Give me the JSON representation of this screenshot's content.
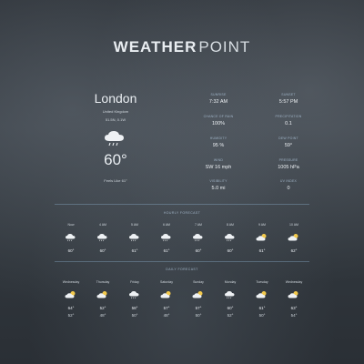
{
  "brand": {
    "part1": "WEATHER",
    "part2": "POINT"
  },
  "current": {
    "city": "London",
    "country": "United Kingdom",
    "coords": "51.5N, 0.1W",
    "temperature": "60°",
    "feels_like": "Feels Like 61°",
    "icon": "cloud-rain-icon"
  },
  "metrics": [
    {
      "label": "SUNRISE",
      "value": "7:32 AM"
    },
    {
      "label": "SUNSET",
      "value": "5:57 PM"
    },
    {
      "label": "CHANCE OF RAIN",
      "value": "100%"
    },
    {
      "label": "PRECIPITATION",
      "value": "0.1"
    },
    {
      "label": "HUMIDITY",
      "value": "95 %"
    },
    {
      "label": "DEW POINT",
      "value": "59°"
    },
    {
      "label": "WIND",
      "value": "SW 16 mph"
    },
    {
      "label": "PRESSURE",
      "value": "1005 hPa"
    },
    {
      "label": "VISIBILITY",
      "value": "5.0 mi"
    },
    {
      "label": "UV INDEX",
      "value": "0"
    }
  ],
  "hourly": {
    "title": "HOURLY FORECAST",
    "items": [
      {
        "time": "Now",
        "temp": "60°",
        "icon": "cloud-rain-icon"
      },
      {
        "time": "4 AM",
        "temp": "60°",
        "icon": "cloud-rain-icon"
      },
      {
        "time": "5 AM",
        "temp": "61°",
        "icon": "cloud-rain-icon"
      },
      {
        "time": "6 AM",
        "temp": "61°",
        "icon": "cloud-rain-icon"
      },
      {
        "time": "7 AM",
        "temp": "60°",
        "icon": "cloud-rain-icon"
      },
      {
        "time": "8 AM",
        "temp": "60°",
        "icon": "cloud-rain-icon"
      },
      {
        "time": "9 AM",
        "temp": "61°",
        "icon": "partly-cloudy-icon"
      },
      {
        "time": "10 AM",
        "temp": "62°",
        "icon": "partly-cloudy-icon"
      }
    ]
  },
  "daily": {
    "title": "DAILY FORECAST",
    "items": [
      {
        "day": "Wednesday",
        "high": "64°",
        "low": "52°",
        "icon": "partly-cloudy-icon"
      },
      {
        "day": "Thursday",
        "high": "52°",
        "low": "48°",
        "icon": "partly-cloudy-icon"
      },
      {
        "day": "Friday",
        "high": "58°",
        "low": "50°",
        "icon": "cloud-rain-icon"
      },
      {
        "day": "Saturday",
        "high": "57°",
        "low": "48°",
        "icon": "partly-cloudy-icon"
      },
      {
        "day": "Sunday",
        "high": "57°",
        "low": "50°",
        "icon": "partly-cloudy-icon"
      },
      {
        "day": "Monday",
        "high": "60°",
        "low": "52°",
        "icon": "cloud-rain-icon"
      },
      {
        "day": "Tuesday",
        "high": "61°",
        "low": "50°",
        "icon": "partly-cloudy-icon"
      },
      {
        "day": "Wednesday",
        "high": "63°",
        "low": "54°",
        "icon": "partly-cloudy-icon"
      }
    ]
  },
  "colors": {
    "accent": "#9fb3c6",
    "sun": "#f2c94c",
    "cloud": "#eef1f4"
  }
}
